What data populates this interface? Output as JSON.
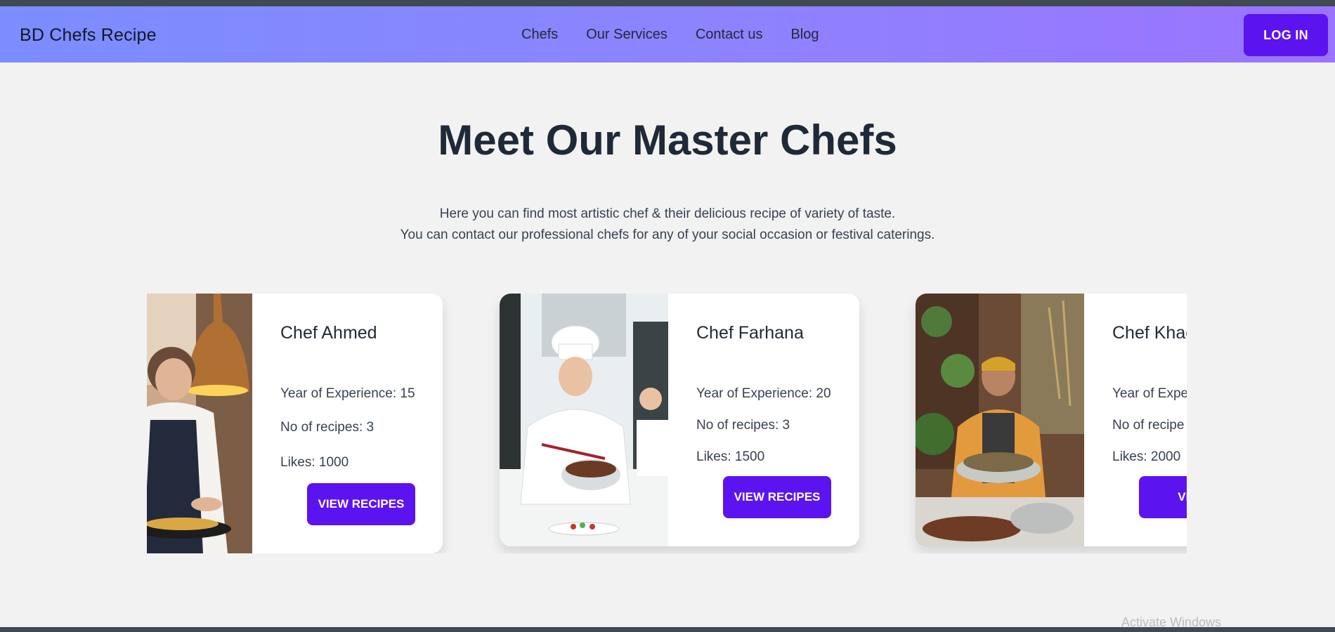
{
  "brand": "BD Chefs Recipe",
  "nav": {
    "links": [
      "Chefs",
      "Our Services",
      "Contact us",
      "Blog"
    ],
    "login_label": "LOG IN"
  },
  "hero": {
    "title": "Meet Our Master Chefs",
    "subtitle_line1": "Here you can find most artistic chef & their delicious recipe of variety of taste.",
    "subtitle_line2": "You can contact our professional chefs for any of your social occasion or festival caterings."
  },
  "chefs": [
    {
      "name": "Chef Ahmed",
      "experience": "Year of Experience: 15",
      "recipes": "No of recipes: 3",
      "likes": "Likes: 1000",
      "button": "VIEW RECIPES"
    },
    {
      "name": "Chef Farhana",
      "experience": "Year of Experience: 20",
      "recipes": "No of recipes: 3",
      "likes": "Likes: 1500",
      "button": "VIEW RECIPES"
    },
    {
      "name": "Chef Khac",
      "experience": "Year of Expe",
      "recipes": "No of recipe",
      "likes": "Likes: 2000",
      "button": "VIEW"
    }
  ],
  "watermark": "Activate Windows",
  "colors": {
    "accent": "#5b14f0",
    "nav_gradient_start": "#7b8dff",
    "nav_gradient_end": "#9a74ff",
    "page_bg": "#f2f2f2"
  }
}
